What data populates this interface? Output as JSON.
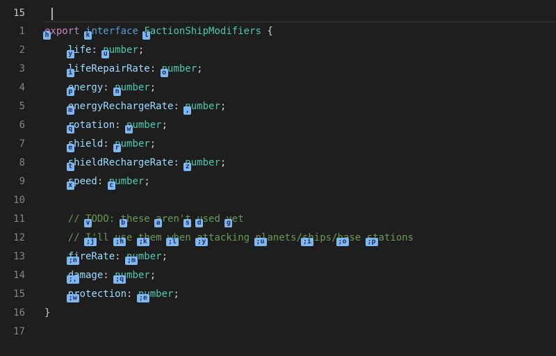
{
  "top_line_number": "15",
  "line_numbers": [
    "1",
    "2",
    "3",
    "4",
    "5",
    "6",
    "7",
    "8",
    "9",
    "10",
    "11",
    "12",
    "13",
    "14",
    "15",
    "16",
    "17"
  ],
  "code": {
    "l1": {
      "export": "export",
      "interface": "interface",
      "name": "FactionShipModifiers",
      "brace": " {"
    },
    "l2": {
      "prop": "life",
      "colon": ": ",
      "type": "number",
      "semi": ";"
    },
    "l3": {
      "prop": "lifeRepairRate",
      "colon": ": ",
      "type": "number",
      "semi": ";"
    },
    "l4": {
      "prop": "energy",
      "colon": ": ",
      "type": "number",
      "semi": ";"
    },
    "l5": {
      "prop": "energyRechargeRate",
      "colon": ": ",
      "type": "number",
      "semi": ";"
    },
    "l6": {
      "prop": "rotation",
      "colon": ": ",
      "type": "number",
      "semi": ";"
    },
    "l7": {
      "prop": "shield",
      "colon": ": ",
      "type": "number",
      "semi": ";"
    },
    "l8": {
      "prop": "shieldRechargeRate",
      "colon": ": ",
      "type": "number",
      "semi": ";"
    },
    "l9": {
      "prop": "speed",
      "colon": ": ",
      "type": "number",
      "semi": ";"
    },
    "l11": "// TODO: these aren't used yet",
    "l12": "// I'll use them when attacking planets/ships/base stations",
    "l13": {
      "prop": "fireRate",
      "colon": ": ",
      "type": "number",
      "semi": ";"
    },
    "l14": {
      "prop": "damage",
      "colon": ": ",
      "type": "number",
      "semi": ";"
    },
    "l15": {
      "prop": "protection",
      "colon": ": ",
      "type": "number",
      "semi": ";"
    },
    "l16": "}"
  },
  "hints": {
    "l1": {
      "h": "h",
      "k": "k",
      "l": "l"
    },
    "l2": {
      "y": "y",
      "u": "u"
    },
    "l3": {
      "i": "i",
      "o": "o"
    },
    "l4": {
      "p": "p",
      "n": "n"
    },
    "l5": {
      "m": "m",
      "comma": ","
    },
    "l6": {
      "q": "q",
      "w": "w"
    },
    "l7": {
      "e": "e",
      "r": "r"
    },
    "l8": {
      "t": "t",
      "z": "z"
    },
    "l9": {
      "x": "x",
      "c": "c"
    },
    "l11": {
      "v": "v",
      "b": "b",
      "a": "a",
      "s": "s",
      "d": "d",
      "g": "g"
    },
    "l12": {
      "j": ";j",
      "h": ";h",
      "k": ";k",
      "l": ";l",
      "y": ";y",
      "u": ";u",
      "i": ";i",
      "o": ";o",
      "p": ";p"
    },
    "l13": {
      "n": ";n",
      "m": ";m"
    },
    "l14": {
      "comma": ";,",
      "q": ";q"
    },
    "l15": {
      "w": ";w",
      "e": ";e"
    }
  }
}
